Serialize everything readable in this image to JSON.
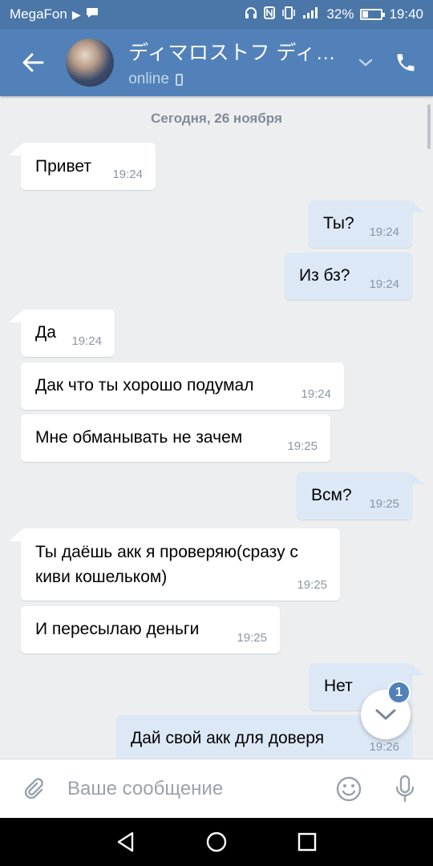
{
  "status_bar": {
    "carrier": "MegaFon",
    "battery_percent": "32%",
    "battery_level": 0.32,
    "time": "19:40",
    "icons": [
      "play-icon",
      "message-icon",
      "headphones-icon",
      "nfc-icon",
      "vibrate-icon",
      "signal-icon",
      "battery-icon"
    ]
  },
  "header": {
    "contact_name": "ディマロストフ ディマ...",
    "status": "online",
    "icons": [
      "back-arrow-icon",
      "chevron-down-icon",
      "phone-icon",
      "mobile-device-icon"
    ]
  },
  "chat": {
    "date_separator": "Сегодня, 26 ноября",
    "messages": [
      {
        "direction": "in",
        "text": "Привет",
        "time": "19:24"
      },
      {
        "direction": "out",
        "text": "Ты?",
        "time": "19:24"
      },
      {
        "direction": "out",
        "text": "Из бз?",
        "time": "19:24"
      },
      {
        "direction": "in",
        "text": "Да",
        "time": "19:24"
      },
      {
        "direction": "in",
        "text": "Дак что ты хорошо подумал",
        "time": "19:24"
      },
      {
        "direction": "in",
        "text": "Мне обманывать не зачем",
        "time": "19:25"
      },
      {
        "direction": "out",
        "text": "Всм?",
        "time": "19:25"
      },
      {
        "direction": "in",
        "text": "Ты даёшь акк я проверяю(сразу с киви кошельком)",
        "time": "19:25"
      },
      {
        "direction": "in",
        "text": "И пересылаю деньги",
        "time": "19:25"
      },
      {
        "direction": "out",
        "text": "Нет",
        "time": ""
      },
      {
        "direction": "out",
        "text": "Дай свой акк для доверя",
        "time": "19:26"
      }
    ],
    "unread_count": "1"
  },
  "composer": {
    "placeholder": "Ваше сообщение",
    "icons": [
      "paperclip-icon",
      "emoji-icon",
      "microphone-icon"
    ]
  },
  "navigation": {
    "icons": [
      "nav-back-icon",
      "nav-home-icon",
      "nav-recents-icon"
    ]
  },
  "colors": {
    "header": "#5181b8",
    "status_bar": "#4a76a8",
    "chat_background": "#edeef0",
    "incoming_bubble": "#ffffff",
    "outgoing_bubble": "#dce8f6",
    "accent": "#5181b8"
  }
}
